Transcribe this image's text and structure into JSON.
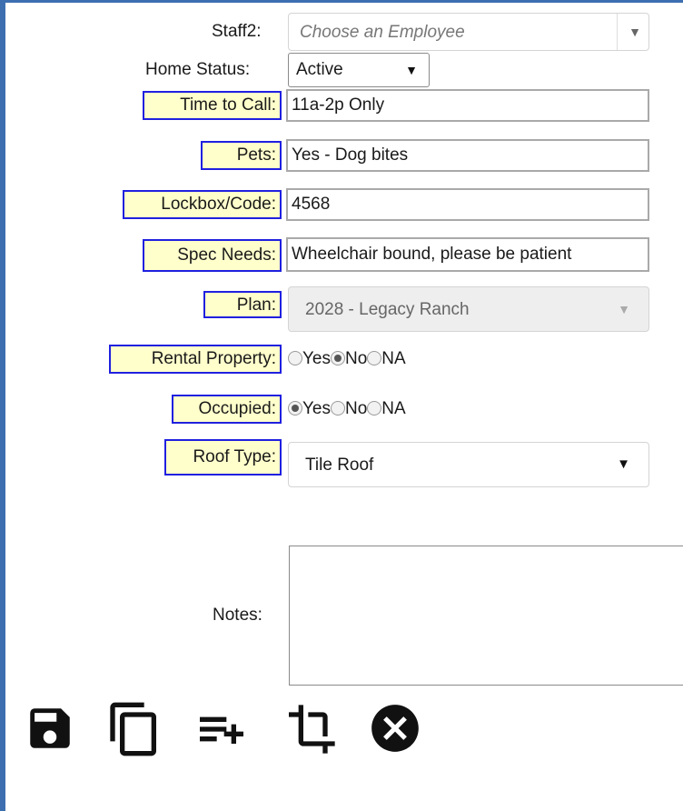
{
  "fields": {
    "staff2": {
      "label": "Staff2:",
      "placeholder": "Choose an Employee"
    },
    "home_status": {
      "label": "Home Status:",
      "value": "Active"
    },
    "time_to_call": {
      "label": "Time to Call:",
      "value": "11a-2p Only"
    },
    "pets": {
      "label": "Pets:",
      "value": "Yes - Dog bites"
    },
    "lockbox": {
      "label": "Lockbox/Code:",
      "value": "4568"
    },
    "spec_needs": {
      "label": "Spec Needs:",
      "value": "Wheelchair bound, please be patient"
    },
    "plan": {
      "label": "Plan:",
      "value": "2028 - Legacy Ranch"
    },
    "rental_property": {
      "label": "Rental Property:",
      "options": [
        "Yes",
        "No",
        "NA"
      ],
      "selected": "No"
    },
    "occupied": {
      "label": "Occupied:",
      "options": [
        "Yes",
        "No",
        "NA"
      ],
      "selected": "Yes"
    },
    "roof_type": {
      "label": "Roof Type:",
      "value": "Tile Roof"
    },
    "notes": {
      "label": "Notes:",
      "value": ""
    }
  },
  "toolbar": {
    "icons": [
      "save-icon",
      "copy-icon",
      "add-to-list-icon",
      "crop-icon",
      "cancel-icon"
    ]
  },
  "colors": {
    "highlight_bg": "#ffffcc",
    "highlight_border": "#2020e0",
    "frame_border": "#3d6fb0"
  }
}
